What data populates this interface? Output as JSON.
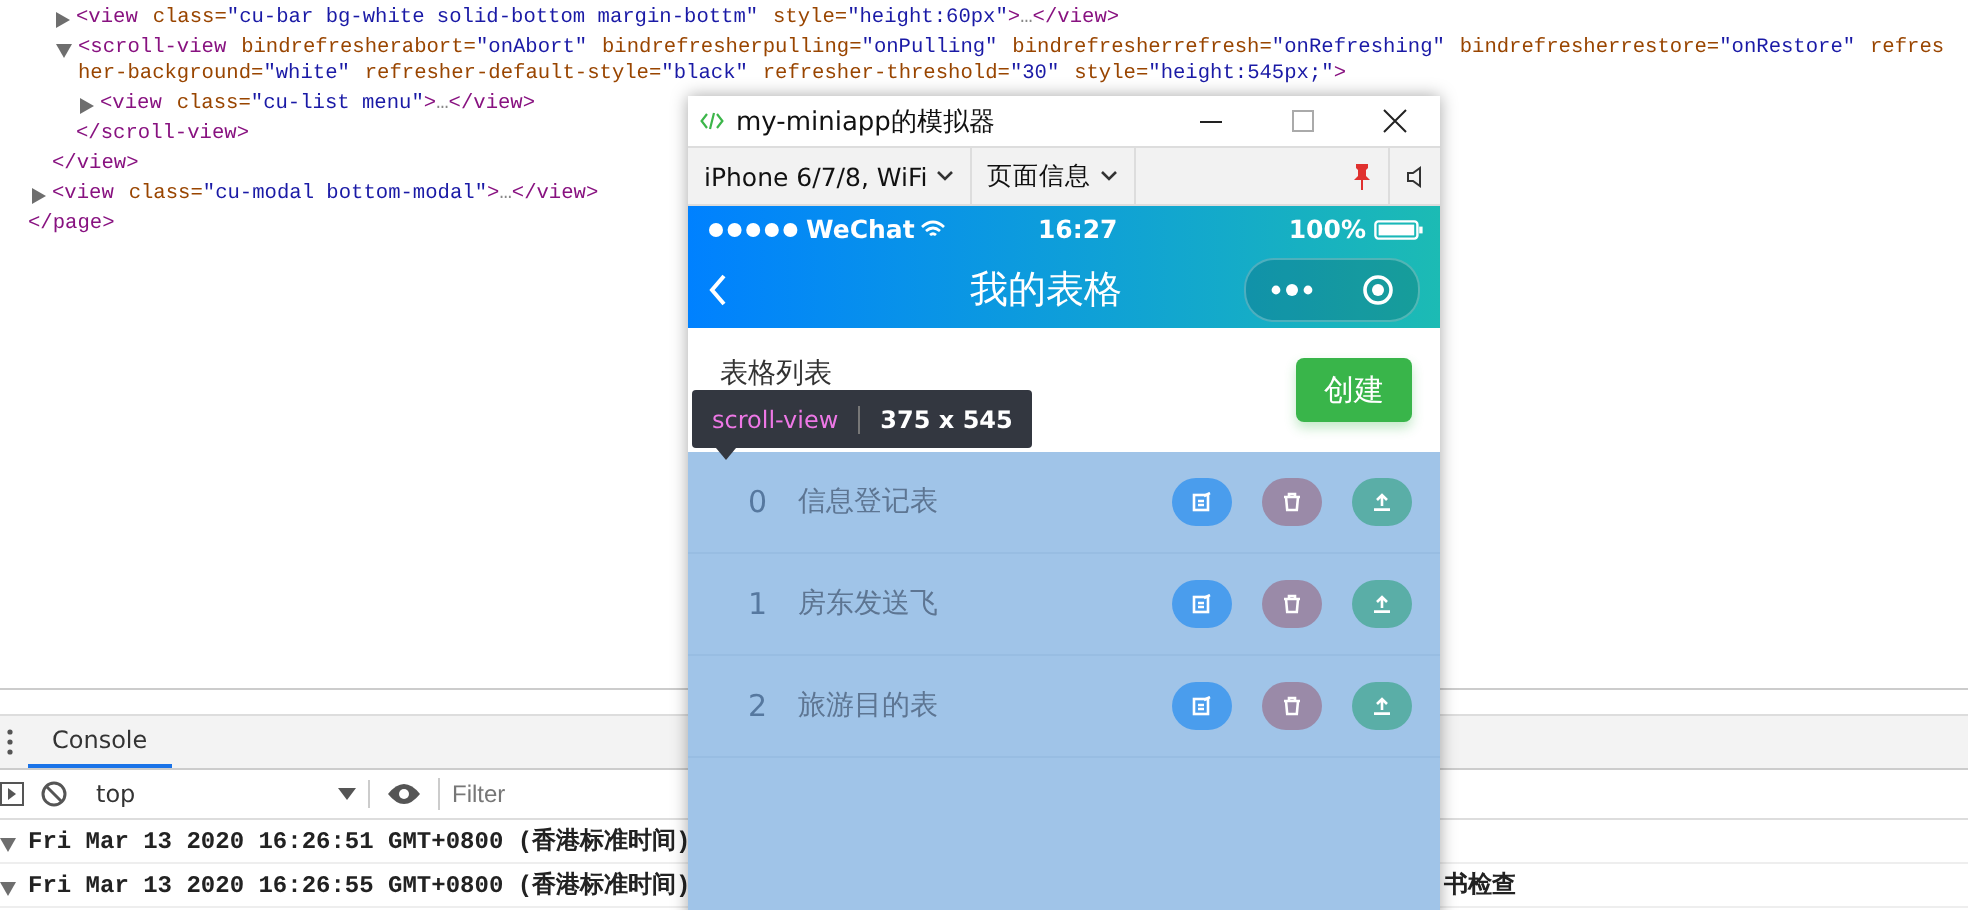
{
  "elements": {
    "tree": [
      {
        "close": [
          {
            "kind": "tag",
            "text": "</page>"
          }
        ],
        "children": [
          {
            "close": [
              {
                "kind": "tag",
                "text": "</view>"
              }
            ],
            "children": [
              {
                "expanded": false,
                "tokens": [
                  {
                    "kind": "tag",
                    "text": "<view"
                  },
                  {
                    "kind": "attr",
                    "text": "class="
                  },
                  {
                    "kind": "value",
                    "text": "\"cu-bar bg-white solid-bottom margin-bottm\""
                  },
                  {
                    "kind": "attr",
                    "text": "style="
                  },
                  {
                    "kind": "value",
                    "text": "\"height:60px\""
                  },
                  {
                    "kind": "tag",
                    "text": ">"
                  },
                  {
                    "kind": "ellipsis",
                    "text": "…"
                  },
                  {
                    "kind": "tag",
                    "text": "</view>"
                  }
                ]
              },
              {
                "expanded": true,
                "tokens": [
                  {
                    "kind": "tag",
                    "text": "<scroll-view"
                  },
                  {
                    "kind": "attr",
                    "text": "bindrefresherabort="
                  },
                  {
                    "kind": "value",
                    "text": "\"onAbort\""
                  },
                  {
                    "kind": "attr",
                    "text": "bindrefresherpulling="
                  },
                  {
                    "kind": "value",
                    "text": "\"onPulling\""
                  },
                  {
                    "kind": "attr",
                    "text": "bindrefresherrefresh="
                  },
                  {
                    "kind": "value",
                    "text": "\"onRefreshing\""
                  },
                  {
                    "kind": "attr",
                    "text": "bindrefresherrestore="
                  },
                  {
                    "kind": "value",
                    "text": "\"onRestore\""
                  },
                  {
                    "kind": "attr",
                    "text": "refresher-background="
                  },
                  {
                    "kind": "value",
                    "text": "\"white\""
                  },
                  {
                    "kind": "attr",
                    "text": "refresher-default-style="
                  },
                  {
                    "kind": "value",
                    "text": "\"black\""
                  },
                  {
                    "kind": "attr",
                    "text": "refresher-threshold="
                  },
                  {
                    "kind": "value",
                    "text": "\"30\""
                  },
                  {
                    "kind": "attr",
                    "text": "style="
                  },
                  {
                    "kind": "value",
                    "text": "\"height:545px;\""
                  },
                  {
                    "kind": "tag",
                    "text": ">"
                  }
                ],
                "close": [
                  {
                    "kind": "tag",
                    "text": "</scroll-view>"
                  }
                ],
                "children": [
                  {
                    "expanded": false,
                    "tokens": [
                      {
                        "kind": "tag",
                        "text": "<view"
                      },
                      {
                        "kind": "attr",
                        "text": "class="
                      },
                      {
                        "kind": "value",
                        "text": "\"cu-list menu\""
                      },
                      {
                        "kind": "tag",
                        "text": ">"
                      },
                      {
                        "kind": "ellipsis",
                        "text": "…"
                      },
                      {
                        "kind": "tag",
                        "text": "</view>"
                      }
                    ]
                  }
                ]
              }
            ]
          },
          {
            "expanded": false,
            "tokens": [
              {
                "kind": "tag",
                "text": "<view"
              },
              {
                "kind": "attr",
                "text": "class="
              },
              {
                "kind": "value",
                "text": "\"cu-modal bottom-modal\""
              },
              {
                "kind": "tag",
                "text": ">"
              },
              {
                "kind": "ellipsis",
                "text": "…"
              },
              {
                "kind": "tag",
                "text": "</view>"
              }
            ]
          }
        ]
      }
    ]
  },
  "console": {
    "tabs": [
      {
        "label": "Console",
        "selected": true
      }
    ],
    "context": "top",
    "filter_placeholder": "Filter",
    "logs": [
      {
        "expanded": true,
        "text": "Fri Mar 13 2020 16:26:51 GMT+0800 (香港标准时间)"
      },
      {
        "expanded": true,
        "text": "Fri Mar 13 2020 16:26:55 GMT+0800 (香港标准时间)",
        "tail": "书检查"
      }
    ]
  },
  "simulator": {
    "title": "my-miniapp的模拟器",
    "device": "iPhone 6/7/8, WiFi",
    "page_info": "页面信息",
    "status": {
      "carrier": "WeChat",
      "time": "16:27",
      "battery": "100%"
    },
    "nav_title": "我的表格",
    "section_title": "表格列表",
    "create_button": "创建",
    "tooltip": {
      "tag": "scroll-view",
      "size": "375 x 545"
    },
    "rows": [
      {
        "index": "0",
        "name": "信息登记表"
      },
      {
        "index": "1",
        "name": "房东发送飞"
      },
      {
        "index": "2",
        "name": "旅游目的表"
      }
    ]
  }
}
